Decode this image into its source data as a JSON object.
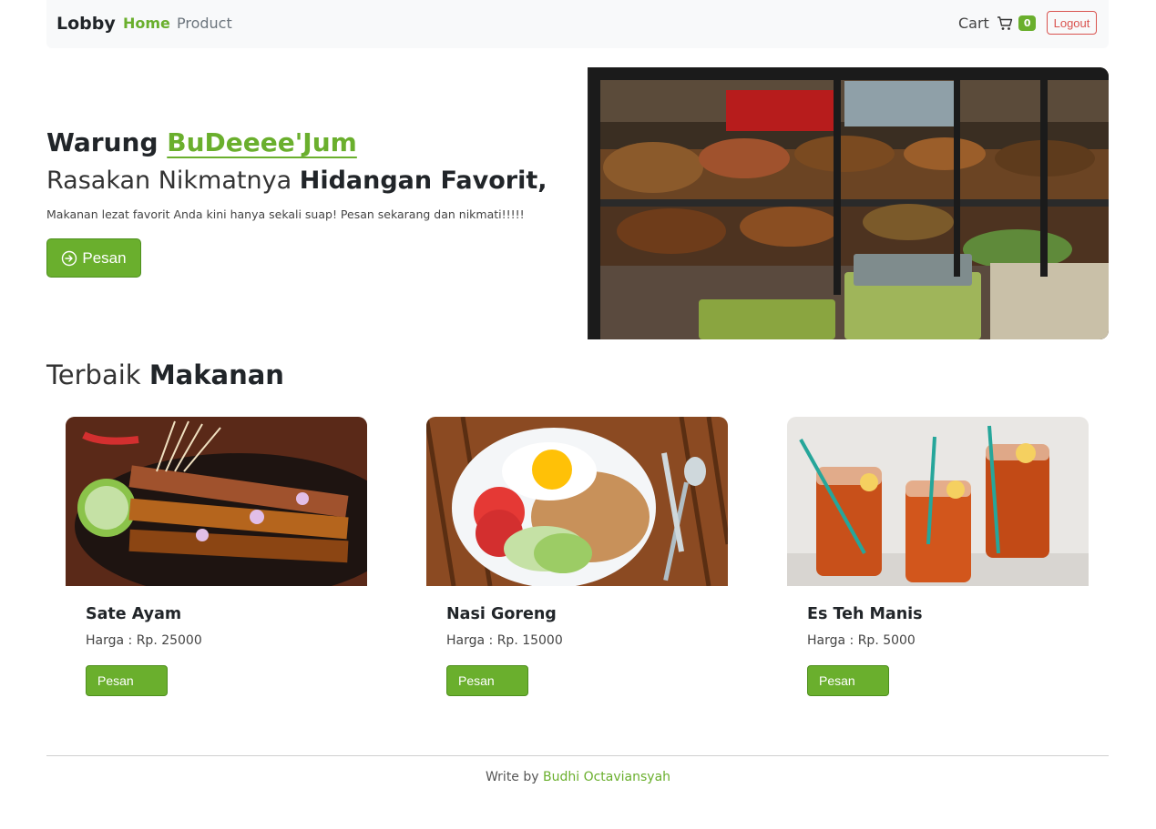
{
  "navbar": {
    "brand": "Lobby",
    "links": [
      {
        "label": "Home"
      },
      {
        "label": "Product"
      }
    ],
    "cart_label": "Cart",
    "cart_count": "0",
    "logout_label": "Logout"
  },
  "hero": {
    "title_prefix": "Warung",
    "title_accent": "BuDeeee'Jum",
    "subtitle_light": "Rasakan Nikmatnya",
    "subtitle_bold": "Hidangan Favorit,",
    "description": "Makanan lezat favorit Anda kini hanya sekali suap! Pesan sekarang dan nikmati!!!!!",
    "button_label": "Pesan"
  },
  "section": {
    "title_light": "Terbaik",
    "title_bold": "Makanan"
  },
  "products": [
    {
      "name": "Sate Ayam",
      "price": "Harga : Rp. 25000",
      "button": "Pesan"
    },
    {
      "name": "Nasi Goreng",
      "price": "Harga : Rp. 15000",
      "button": "Pesan"
    },
    {
      "name": "Es Teh Manis",
      "price": "Harga : Rp. 5000",
      "button": "Pesan"
    }
  ],
  "footer": {
    "prefix": "Write by",
    "author": "Budhi Octaviansyah"
  },
  "colors": {
    "accent": "#6aaf2d",
    "logout": "#d9534f",
    "navbar_bg": "#f8f9fa"
  }
}
